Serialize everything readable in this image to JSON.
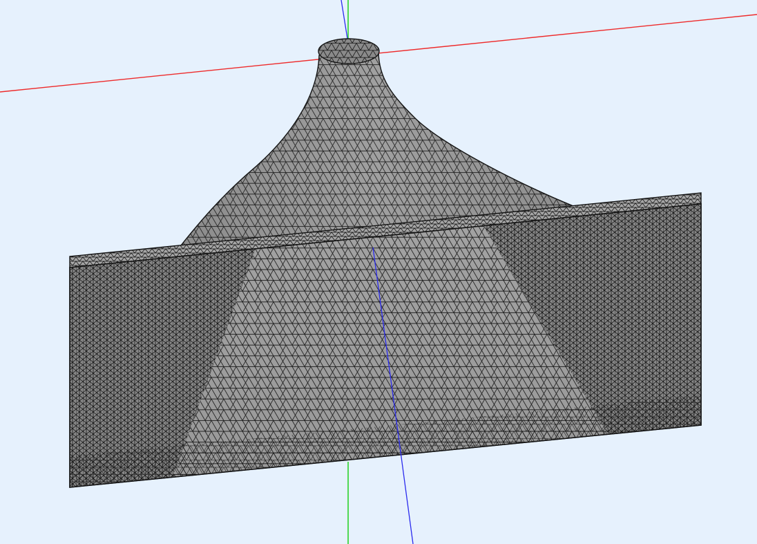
{
  "viewport": {
    "background_color": "#e6f1fd",
    "axes": {
      "x_color": "#ee2a2a",
      "y_color": "#2ad22a",
      "z_color": "#2a2aee"
    },
    "mesh": {
      "element_type": "triangular",
      "surface_color": "#9a9a9a",
      "edge_color": "#141414",
      "shape": "horn"
    }
  }
}
